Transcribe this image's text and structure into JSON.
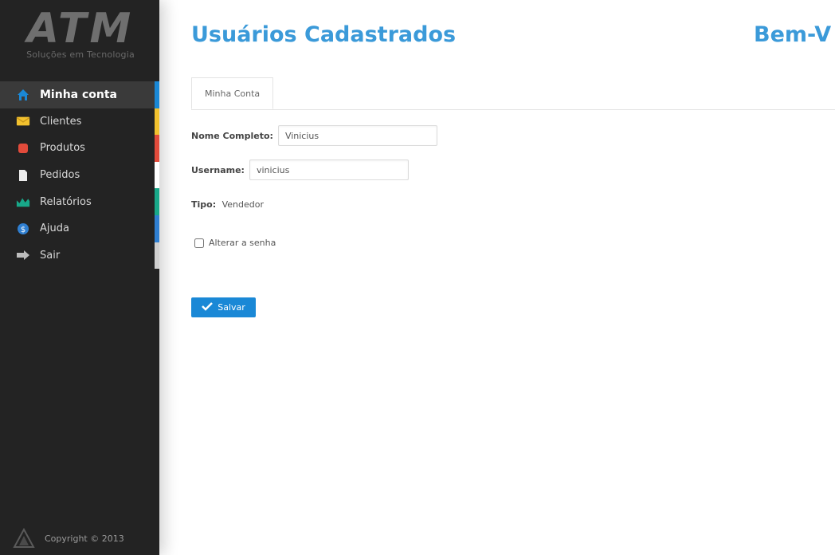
{
  "sidebar": {
    "logo": {
      "mark": "ATM",
      "subtitle": "Soluções em Tecnologia"
    },
    "items": [
      {
        "label": "Minha conta",
        "icon": "home-icon",
        "color": "#1a88d6",
        "active": true
      },
      {
        "label": "Clientes",
        "icon": "clients-icon",
        "color": "#f2c12e"
      },
      {
        "label": "Produtos",
        "icon": "products-icon",
        "color": "#e24b3b"
      },
      {
        "label": "Pedidos",
        "icon": "orders-icon",
        "color": "#ffffff"
      },
      {
        "label": "Relatórios",
        "icon": "reports-icon",
        "color": "#18a889"
      },
      {
        "label": "Ajuda",
        "icon": "help-icon",
        "color": "#2f7fd1"
      },
      {
        "label": "Sair",
        "icon": "logout-icon",
        "color": "#cfcfcf"
      }
    ],
    "copyright": "Copyright © 2013"
  },
  "main": {
    "title": "Usuários Cadastrados",
    "welcome": "Bem-V",
    "tab_label": "Minha Conta",
    "form": {
      "full_name_label": "Nome Completo:",
      "full_name_value": "Vinicius",
      "username_label": "Username:",
      "username_value": "vinicius",
      "type_label": "Tipo:",
      "type_value": "Vendedor",
      "change_password_label": "Alterar a senha",
      "save_label": "Salvar"
    }
  },
  "colors": {
    "accent": "#3b9ad9",
    "button": "#1a88d6",
    "sidebar_bg": "#232323"
  }
}
